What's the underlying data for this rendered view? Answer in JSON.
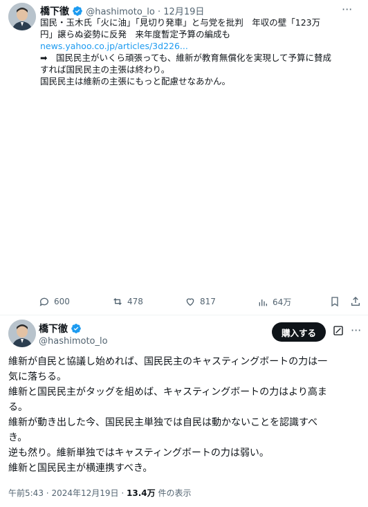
{
  "tweet1": {
    "author_name": "橋下徹",
    "handle": "@hashimoto_lo",
    "date": "12月19日",
    "more_label": "···",
    "quote_title_line1": "国民・玉木氏「火に油」「見切り発車」と与党を批判　年収の壁「123万",
    "quote_title_line2": "円」譲らぬ姿勢に反発　来年度暫定予算の編成も",
    "link_text": "news.yahoo.co.jp/articles/3d226...",
    "arrow_line1": "➡　国民民主がいくら頑張っても、維新が教育無償化を実現して予算に賛成",
    "arrow_line2": "すれば国民民主の主張は終わり。",
    "closing_line": "国民民主は維新の主張にもっと配慮せなあかん。",
    "actions": {
      "replies": "600",
      "reposts": "478",
      "likes": "817",
      "views": "64万"
    }
  },
  "tweet2": {
    "author_name": "橋下徹",
    "handle": "@hashimoto_lo",
    "buy_button_label": "購入する",
    "more_label": "···",
    "lines": [
      "維新が自民と協議し始めれば、国民民主のキャスティングボートの力は一",
      "気に落ちる。",
      "維新と国民民主がタッグを組めば、キャスティングボートの力はより高ま",
      "る。",
      "維新が動き出した今、国民民主単独では自民は動かないことを認識すべ",
      "き。",
      "逆も然り。維新単独ではキャスティングボートの力は弱い。",
      "維新と国民民主が横連携すべき。"
    ],
    "time": "午前5:43",
    "date": "2024年12月19日",
    "views_count": "13.4万",
    "views_label": "件の表示"
  },
  "colors": {
    "accent": "#1d9bf0",
    "text": "#0f1419",
    "muted": "#536471",
    "verified_badge": "#1d9bf0"
  }
}
